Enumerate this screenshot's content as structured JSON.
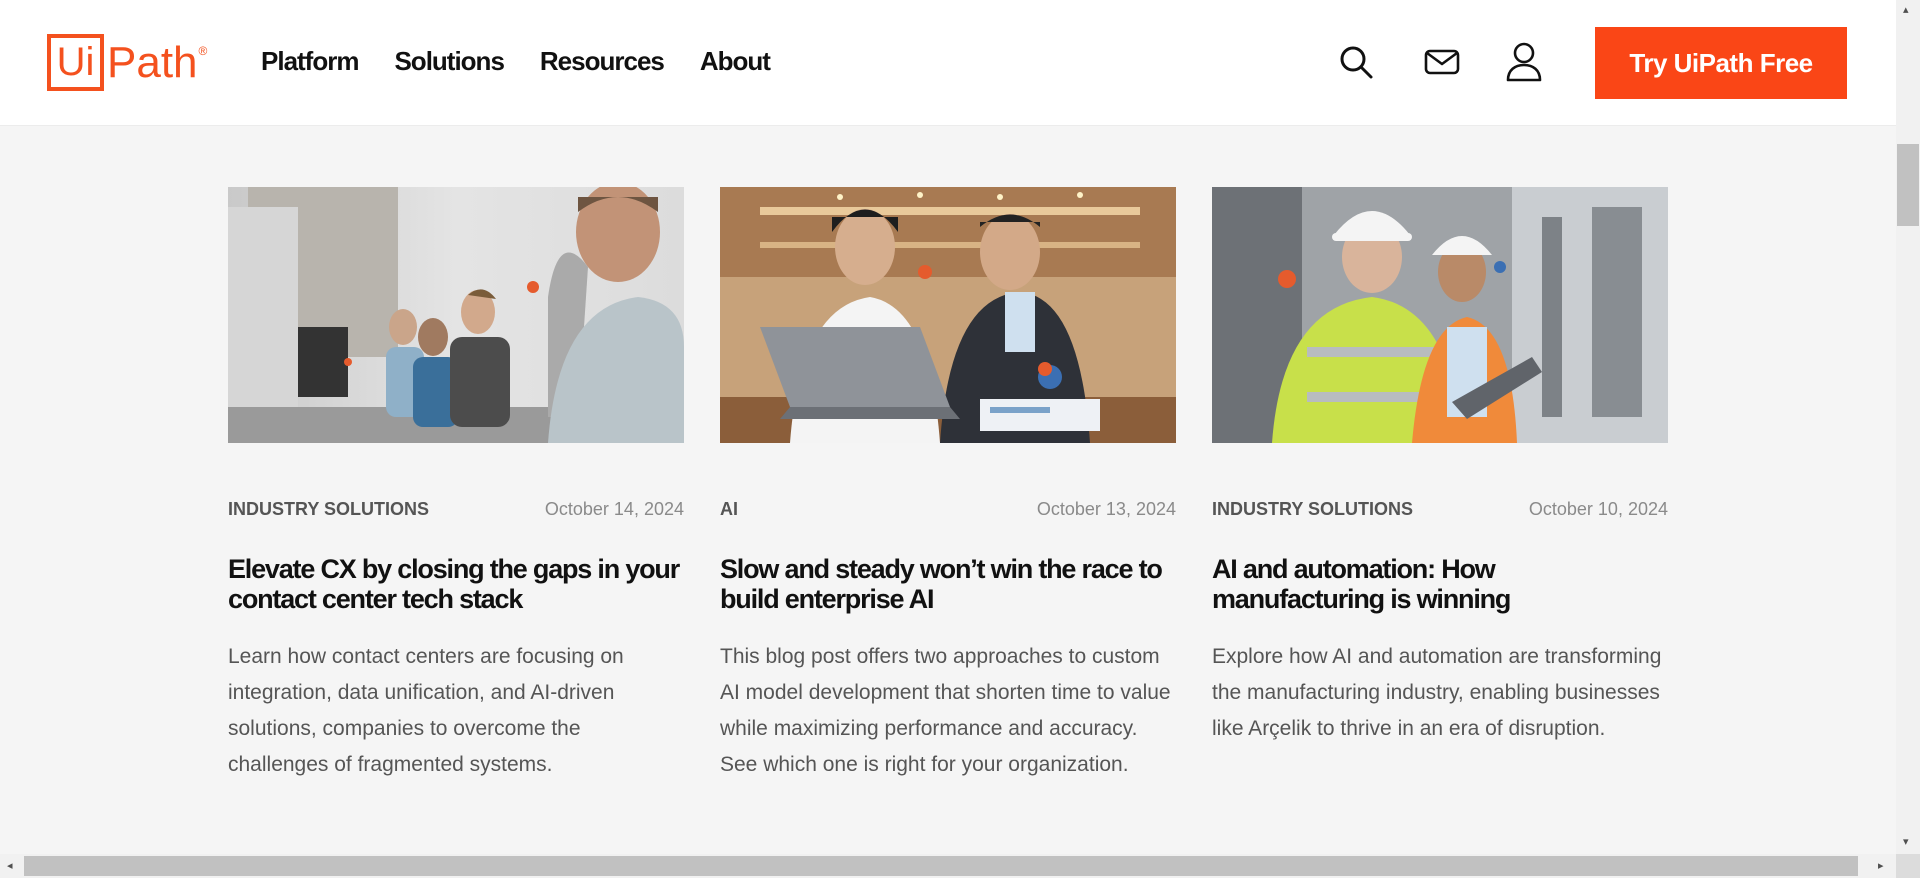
{
  "header": {
    "logo": {
      "box_text": "Ui",
      "text": "Path",
      "registered": "®"
    },
    "nav": [
      "Platform",
      "Solutions",
      "Resources",
      "About"
    ],
    "icons": [
      "search-icon",
      "mail-icon",
      "user-icon"
    ],
    "cta_label": "Try UiPath Free"
  },
  "colors": {
    "brand": "#fa4616",
    "logo": "#f4511e",
    "background": "#f5f5f5"
  },
  "cards": [
    {
      "category": "INDUSTRY SOLUTIONS",
      "date": "October 14, 2024",
      "title": "Elevate CX by closing the gaps in your contact center tech stack",
      "description": "Learn how contact centers are focusing on integration, data unification, and AI-driven solutions, companies to overcome the challenges of fragmented systems.",
      "image": "contact-center-agents-with-headsets-photo"
    },
    {
      "category": "AI",
      "date": "October 13, 2024",
      "title": "Slow and steady won’t win the race to build enterprise AI",
      "description": "This blog post offers two approaches to custom AI model development that shorten time to value while maximizing performance and accuracy. See which one is right for your organization.",
      "image": "two-colleagues-at-laptop-photo"
    },
    {
      "category": "INDUSTRY SOLUTIONS",
      "date": "October 10, 2024",
      "title": "AI and automation: How manufacturing is winning",
      "description": "Explore how AI and automation are transforming the manufacturing industry, enabling businesses like Arçelik to thrive in an era of disruption.",
      "image": "factory-engineers-with-hardhats-photo"
    }
  ]
}
